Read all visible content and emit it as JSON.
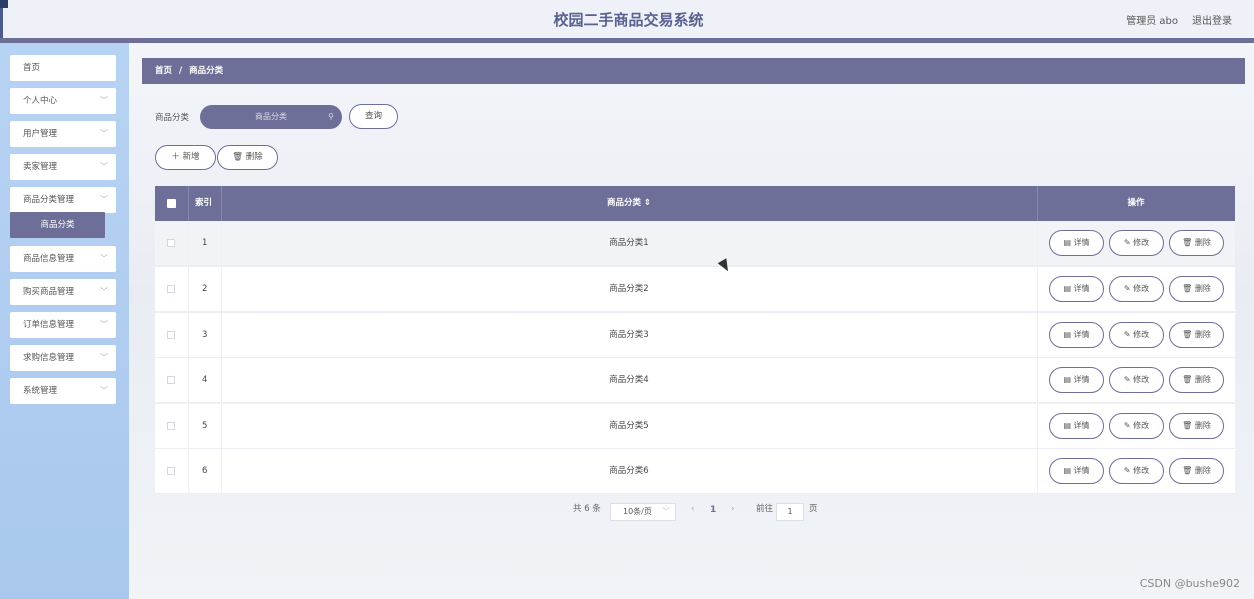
{
  "header": {
    "title": "校园二手商品交易系统",
    "user": "管理员 abo",
    "logout": "退出登录"
  },
  "sidebar": {
    "items": [
      {
        "label": "首页",
        "has_arrow": false
      },
      {
        "label": "个人中心",
        "has_arrow": true
      },
      {
        "label": "用户管理",
        "has_arrow": true
      },
      {
        "label": "卖家管理",
        "has_arrow": true
      },
      {
        "label": "商品分类管理",
        "has_arrow": true
      },
      {
        "label": "商品信息管理",
        "has_arrow": true
      },
      {
        "label": "购买商品管理",
        "has_arrow": true
      },
      {
        "label": "订单信息管理",
        "has_arrow": true
      },
      {
        "label": "求购信息管理",
        "has_arrow": true
      },
      {
        "label": "系统管理",
        "has_arrow": true
      }
    ],
    "active_sub": "商品分类"
  },
  "breadcrumb": {
    "home": "首页",
    "sep": "/",
    "current": "商品分类"
  },
  "search": {
    "label": "商品分类",
    "placeholder": "商品分类",
    "button": "查询"
  },
  "toolbar": {
    "add": "＋ 新增",
    "delete": "🗑 删除"
  },
  "table": {
    "headers": {
      "index": "索引",
      "category": "商品分类 ⇕",
      "actions": "操作"
    },
    "rows": [
      {
        "index": "1",
        "category": "商品分类1"
      },
      {
        "index": "2",
        "category": "商品分类2"
      },
      {
        "index": "3",
        "category": "商品分类3"
      },
      {
        "index": "4",
        "category": "商品分类4"
      },
      {
        "index": "5",
        "category": "商品分类5"
      },
      {
        "index": "6",
        "category": "商品分类6"
      }
    ],
    "actions": {
      "detail": "▤ 详情",
      "edit": "✎ 修改",
      "delete": "🗑 删除"
    }
  },
  "pagination": {
    "total": "共 6 条",
    "page_size": "10条/页",
    "current": "1",
    "goto_label": "前往",
    "goto_value": "1",
    "page_suffix": "页"
  },
  "watermark": "CSDN @bushe902",
  "colors": {
    "accent": "#6d6f98",
    "sidebar": "#b7d3f3"
  }
}
